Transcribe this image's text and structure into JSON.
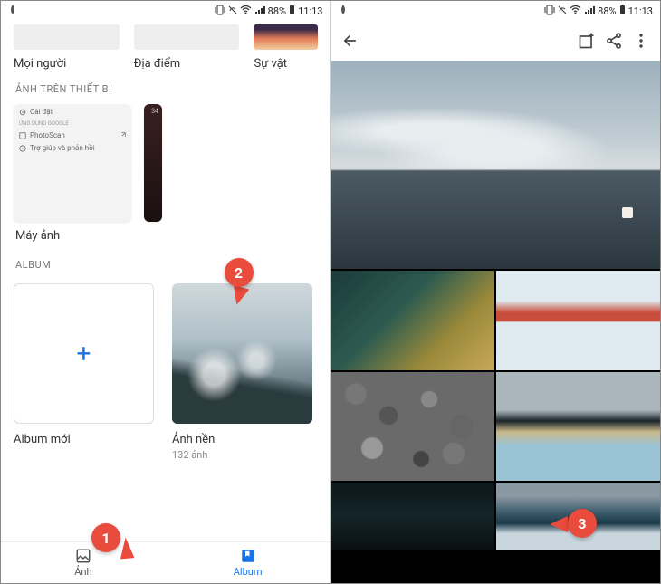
{
  "status": {
    "battery_pct": "88%",
    "time": "11:13"
  },
  "left": {
    "categories": {
      "people": "Mọi người",
      "places": "Địa điểm",
      "things": "Sự vật"
    },
    "device_section": "ẢNH TRÊN THIẾT BỊ",
    "device_menu": {
      "settings": "Cài đặt",
      "apps_header": "ỨNG DỤNG GOOGLE",
      "photoscan": "PhotoScan",
      "help": "Trợ giúp và phản hồi"
    },
    "camera_label": "Máy ảnh",
    "album_section": "ALBUM",
    "new_album_symbol": "+",
    "new_album_label": "Album mới",
    "wallpaper_label": "Ảnh nền",
    "wallpaper_count": "132 ảnh",
    "nav": {
      "photos": "Ảnh",
      "album": "Album"
    }
  },
  "markers": {
    "m1": "1",
    "m2": "2",
    "m3": "3"
  }
}
